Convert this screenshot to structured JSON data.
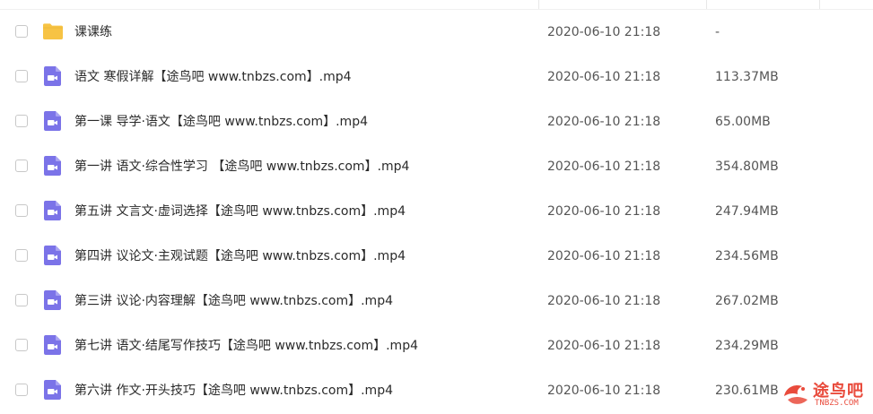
{
  "files": [
    {
      "icon": "folder-icon",
      "name": "课课练",
      "date": "2020-06-10 21:18",
      "size": "-"
    },
    {
      "icon": "video-file-icon",
      "name": "语文 寒假详解【途鸟吧 www.tnbzs.com】.mp4",
      "date": "2020-06-10 21:18",
      "size": "113.37MB"
    },
    {
      "icon": "video-file-icon",
      "name": "第一课 导学·语文【途鸟吧 www.tnbzs.com】.mp4",
      "date": "2020-06-10 21:18",
      "size": "65.00MB"
    },
    {
      "icon": "video-file-icon",
      "name": "第一讲 语文·综合性学习 【途鸟吧 www.tnbzs.com】.mp4",
      "date": "2020-06-10 21:18",
      "size": "354.80MB"
    },
    {
      "icon": "video-file-icon",
      "name": "第五讲 文言文·虚词选择【途鸟吧 www.tnbzs.com】.mp4",
      "date": "2020-06-10 21:18",
      "size": "247.94MB"
    },
    {
      "icon": "video-file-icon",
      "name": "第四讲 议论文·主观试题【途鸟吧 www.tnbzs.com】.mp4",
      "date": "2020-06-10 21:18",
      "size": "234.56MB"
    },
    {
      "icon": "video-file-icon",
      "name": "第三讲 议论·内容理解【途鸟吧 www.tnbzs.com】.mp4",
      "date": "2020-06-10 21:18",
      "size": "267.02MB"
    },
    {
      "icon": "video-file-icon",
      "name": "第七讲 语文·结尾写作技巧【途鸟吧 www.tnbzs.com】.mp4",
      "date": "2020-06-10 21:18",
      "size": "234.29MB"
    },
    {
      "icon": "video-file-icon",
      "name": "第六讲 作文·开头技巧【途鸟吧 www.tnbzs.com】.mp4",
      "date": "2020-06-10 21:18",
      "size": "230.61MB"
    }
  ],
  "watermark": {
    "title": "途鸟吧",
    "subtitle": "TNBZS.COM"
  },
  "colors": {
    "folder": "#f7c344",
    "video": "#7b73e8",
    "watermark": "#e94b3c"
  }
}
